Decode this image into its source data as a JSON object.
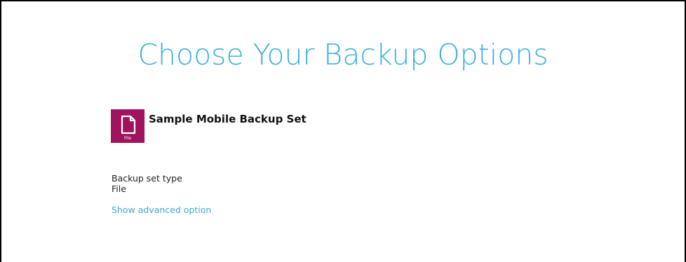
{
  "page": {
    "title": "Choose Your Backup Options"
  },
  "backup_set": {
    "icon": "file-icon",
    "icon_label": "File",
    "icon_color": "#a0135e",
    "name": "Sample Mobile Backup Set"
  },
  "backup_type": {
    "label": "Backup set type",
    "value": "File"
  },
  "advanced": {
    "link_label": "Show advanced option"
  },
  "colors": {
    "title": "#3fb0de",
    "link": "#3fa7d6"
  }
}
